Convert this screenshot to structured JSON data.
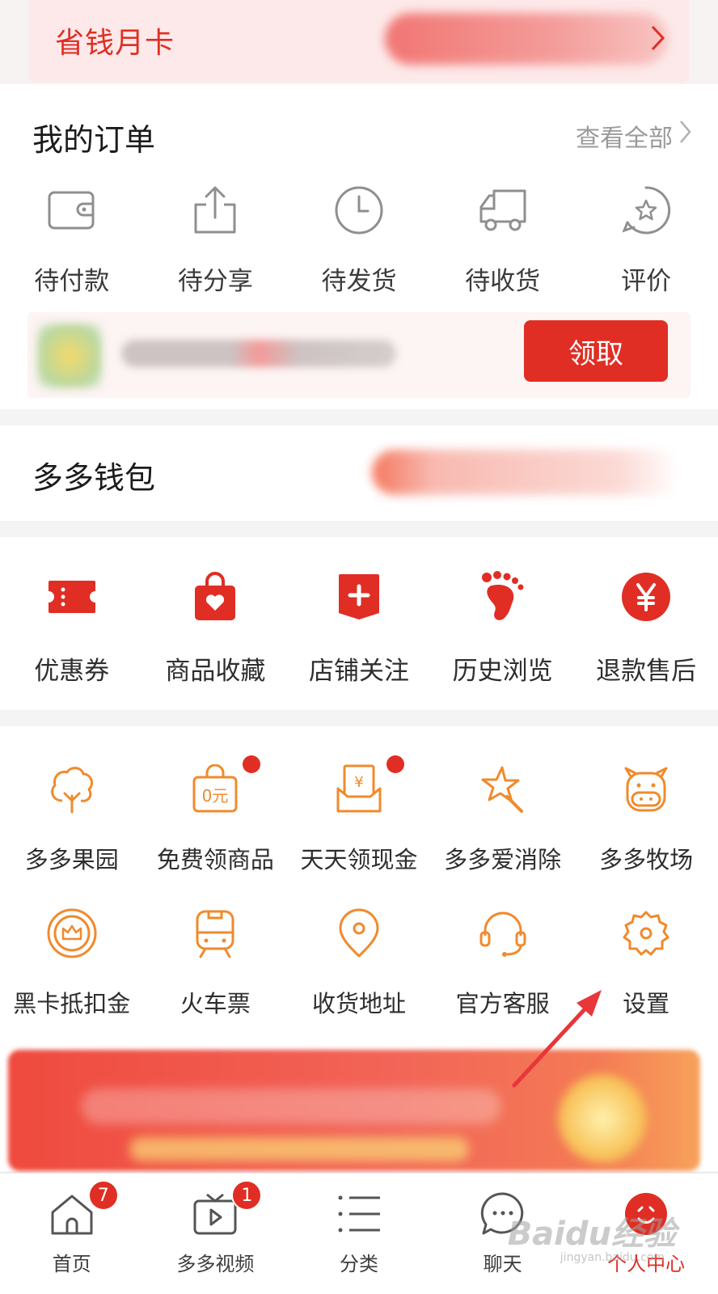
{
  "month_card": {
    "title": "省钱月卡"
  },
  "orders": {
    "title": "我的订单",
    "view_all": "查看全部",
    "items": [
      {
        "label": "待付款",
        "icon": "wallet-icon"
      },
      {
        "label": "待分享",
        "icon": "share-icon"
      },
      {
        "label": "待发货",
        "icon": "clock-icon"
      },
      {
        "label": "待收货",
        "icon": "truck-icon"
      },
      {
        "label": "评价",
        "icon": "star-review-icon"
      }
    ],
    "claim_button": "领取"
  },
  "wallet": {
    "title": "多多钱包"
  },
  "shortcuts": [
    {
      "label": "优惠券",
      "icon": "coupon-icon"
    },
    {
      "label": "商品收藏",
      "icon": "heart-bag-icon"
    },
    {
      "label": "店铺关注",
      "icon": "shop-plus-icon"
    },
    {
      "label": "历史浏览",
      "icon": "footprint-icon"
    },
    {
      "label": "退款售后",
      "icon": "yen-icon"
    }
  ],
  "services": {
    "row1": [
      {
        "label": "多多果园",
        "icon": "tree-icon",
        "dot": false
      },
      {
        "label": "免费领商品",
        "icon": "free-bag-icon",
        "dot": true,
        "icon_text": "0元"
      },
      {
        "label": "天天领现金",
        "icon": "cash-envelope-icon",
        "dot": true,
        "icon_text": "¥"
      },
      {
        "label": "多多爱消除",
        "icon": "star-wand-icon",
        "dot": false
      },
      {
        "label": "多多牧场",
        "icon": "cow-icon",
        "dot": false
      }
    ],
    "row2": [
      {
        "label": "黑卡抵扣金",
        "icon": "crown-coin-icon"
      },
      {
        "label": "火车票",
        "icon": "train-icon"
      },
      {
        "label": "收货地址",
        "icon": "location-pin-icon"
      },
      {
        "label": "官方客服",
        "icon": "headset-icon"
      },
      {
        "label": "设置",
        "icon": "gear-icon"
      }
    ]
  },
  "tabbar": [
    {
      "label": "首页",
      "icon": "home-icon",
      "badge": "7"
    },
    {
      "label": "多多视频",
      "icon": "video-icon",
      "badge": "1"
    },
    {
      "label": "分类",
      "icon": "list-icon",
      "badge": ""
    },
    {
      "label": "聊天",
      "icon": "chat-icon",
      "badge": ""
    },
    {
      "label": "个人中心",
      "icon": "profile-icon",
      "badge": "",
      "active": true
    }
  ],
  "watermark": {
    "text": "Baidu经验",
    "sub": "jingyan.baidu.com"
  },
  "colors": {
    "accent": "#e02e24",
    "service_orange": "#f08a2c",
    "grey_icon": "#8f8f8f"
  }
}
